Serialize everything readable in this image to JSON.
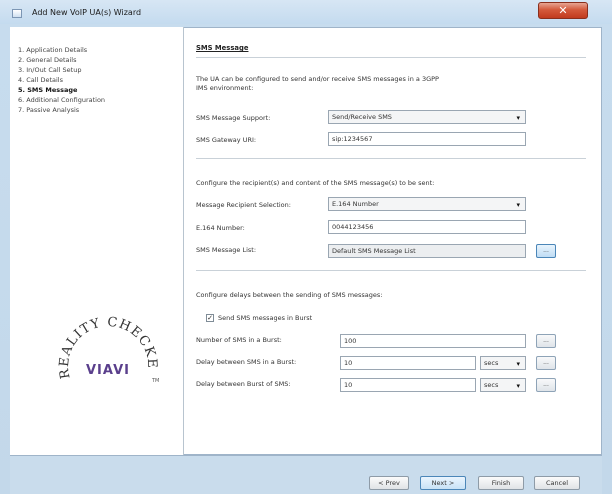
{
  "window": {
    "title": "Add New VoIP UA(s) Wizard",
    "close_glyph": "✕",
    "icon": "wizard-window-icon"
  },
  "steps": [
    {
      "label": "1. Application Details",
      "active": false
    },
    {
      "label": "2. General Details",
      "active": false
    },
    {
      "label": "3. In/Out Call Setup",
      "active": false
    },
    {
      "label": "4. Call Details",
      "active": false
    },
    {
      "label": "5. SMS Message",
      "active": true
    },
    {
      "label": "6. Additional Configuration",
      "active": false
    },
    {
      "label": "7. Passive Analysis",
      "active": false
    }
  ],
  "logo": {
    "top_text": "REALITY CHECKED",
    "tm": "TM",
    "brand": "VIAVI"
  },
  "content": {
    "section_title": "SMS Message",
    "intro": "The UA can be configured to send and/or receive SMS messages in a 3GPP",
    "intro_2": "IMS environment:",
    "sms_support_label": "SMS Message Support:",
    "sms_support_value": "Send/Receive SMS",
    "gateway_label": "SMS Gateway URI:",
    "gateway_value": "sip:1234567",
    "recipients_heading": "Configure the recipient(s) and content of the SMS message(s) to be sent:",
    "recipient_sel_label": "Message Recipient Selection:",
    "recipient_sel_value": "E.164 Number",
    "e164_label": "E.164 Number:",
    "e164_value": "0044123456",
    "msg_list_label": "SMS Message List:",
    "msg_list_value": "Default SMS Message List",
    "delays_heading": "Configure delays between the sending of SMS messages:",
    "burst_checkbox_label": "Send SMS messages in Burst",
    "burst_checked": true,
    "burst_check_glyph": "✓",
    "num_sms_label": "Number of SMS in a Burst:",
    "num_sms_value": "100",
    "delay_sms_label": "Delay between SMS in a Burst:",
    "delay_sms_value": "10",
    "delay_sms_unit": "secs",
    "delay_burst_label": "Delay between Burst of SMS:",
    "delay_burst_value": "10",
    "delay_burst_unit": "secs",
    "ellipsis": "...",
    "dropdown_glyph": "▾"
  },
  "footer": {
    "prev": "< Prev",
    "next": "Next >",
    "finish": "Finish",
    "cancel": "Cancel"
  }
}
